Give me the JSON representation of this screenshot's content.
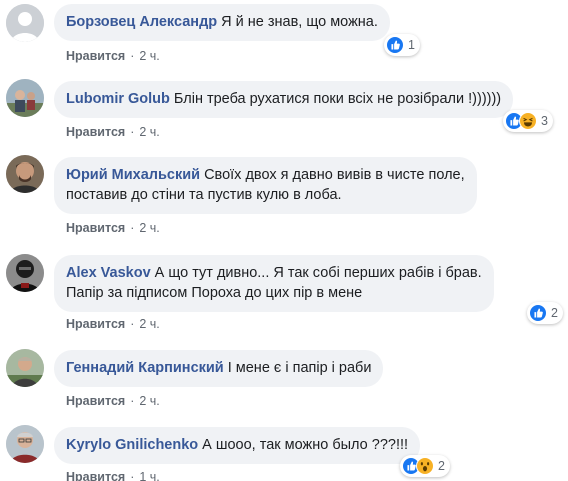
{
  "actions": {
    "like_label": "Нравится",
    "separator": "·"
  },
  "comments": [
    {
      "author": "Борзовец Александр",
      "text": "Я й не знав, що можна.",
      "time": "2 ч.",
      "reactions": [
        "like-icon"
      ],
      "reaction_count": "1"
    },
    {
      "author": "Lubomir Golub",
      "text": "Блін треба рухатися поки всіх не розібрали !))))))",
      "time": "2 ч.",
      "reactions": [
        "like-icon",
        "haha-icon"
      ],
      "reaction_count": "3"
    },
    {
      "author": "Юрий Михальский",
      "text": "Своїх двох я давно вивів в чисте поле,\nпоставив до стіни та пустив кулю в лоба.",
      "time": "2 ч.",
      "reactions": [],
      "reaction_count": ""
    },
    {
      "author": "Alex Vaskov",
      "text": "А що тут дивно... Я так собі перших рабів і брав.\nПапір за підписом Пороха до цих пір в мене",
      "time": "2 ч.",
      "reactions": [
        "like-icon"
      ],
      "reaction_count": "2"
    },
    {
      "author": "Геннадий Карпинский",
      "text": "І мене є і папір і раби",
      "time": "2 ч.",
      "reactions": [],
      "reaction_count": ""
    },
    {
      "author": "Kyrylo Gnilichenko",
      "text": "А шооо, так можно было ???!!!",
      "time": "1 ч.",
      "reactions": [
        "like-icon",
        "wow-icon"
      ],
      "reaction_count": "2"
    }
  ],
  "colors": {
    "link": "#385898",
    "bubble": "#f0f2f5",
    "meta": "#606770",
    "like": "#1877f2",
    "emoji": "#f7b125"
  }
}
